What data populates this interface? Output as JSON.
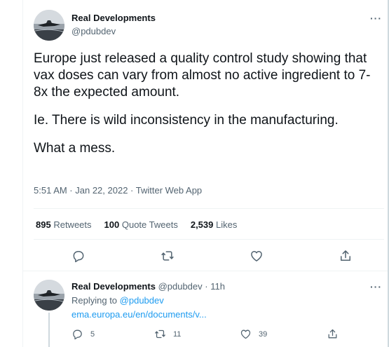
{
  "tweet": {
    "author_name": "Real Developments",
    "author_handle": "@pdubdev",
    "more_label": "···",
    "paragraphs": [
      "Europe just released a quality control study showing that vax doses can vary from almost no active ingredient to 7-8x the expected amount.",
      "Ie. There is wild inconsistency in the manufacturing.",
      "What a mess."
    ],
    "meta": "5:51 AM · Jan 22, 2022 · Twitter Web App",
    "stats": {
      "retweets_count": "895",
      "retweets_label": "Retweets",
      "quotes_count": "100",
      "quotes_label": "Quote Tweets",
      "likes_count": "2,539",
      "likes_label": "Likes"
    },
    "actions": [
      "reply-icon",
      "retweet-icon",
      "like-icon",
      "share-icon"
    ]
  },
  "reply": {
    "author_name": "Real Developments",
    "author_handle": "@pdubdev",
    "time": "· 11h",
    "more_label": "···",
    "replying_prefix": "Replying to",
    "replying_to": "@pdubdev",
    "link": "ema.europa.eu/en/documents/v...",
    "reply_count": "5",
    "retweet_count": "11",
    "like_count": "39"
  },
  "colors": {
    "text": "#0f1419",
    "secondary": "#536471",
    "link": "#1d9bf0",
    "divider": "#eff3f4"
  }
}
